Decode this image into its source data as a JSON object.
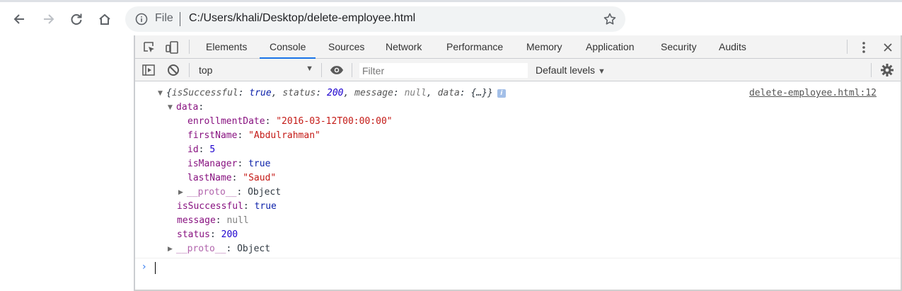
{
  "browser": {
    "scheme_label": "File",
    "url": "C:/Users/khali/Desktop/delete-employee.html",
    "icons": [
      "back-arrow-icon",
      "forward-arrow-icon",
      "reload-icon",
      "home-icon",
      "info-icon",
      "star-icon"
    ]
  },
  "devtools": {
    "tabs": [
      "Elements",
      "Console",
      "Sources",
      "Network",
      "Performance",
      "Memory",
      "Application",
      "Security",
      "Audits"
    ],
    "active_tab": "Console",
    "toolbar": {
      "context": "top",
      "filter_placeholder": "Filter",
      "levels": "Default levels"
    },
    "colors": {
      "accent": "#1a73e8",
      "string": "#c41a16",
      "number": "#1c00cf",
      "key": "#881280"
    }
  },
  "console": {
    "summary": "{isSuccessful: true, status: 200, message: null, data: {…}}",
    "summary_parts": {
      "open": "{",
      "k1": "isSuccessful",
      "v1": "true",
      "k2": "status",
      "v2": "200",
      "k3": "message",
      "v3": "null",
      "k4": "data",
      "v4": "{…}",
      "close": "}"
    },
    "source": "delete-employee.html:12",
    "data_key": "data",
    "data": {
      "enrollmentDate_key": "enrollmentDate",
      "enrollmentDate": "\"2016-03-12T00:00:00\"",
      "firstName_key": "firstName",
      "firstName": "\"Abdulrahman\"",
      "id_key": "id",
      "id": "5",
      "isManager_key": "isManager",
      "isManager": "true",
      "lastName_key": "lastName",
      "lastName": "\"Saud\"",
      "proto_key": "__proto__",
      "proto": "Object"
    },
    "top": {
      "isSuccessful_key": "isSuccessful",
      "isSuccessful": "true",
      "message_key": "message",
      "message": "null",
      "status_key": "status",
      "status": "200",
      "proto_key": "__proto__",
      "proto": "Object"
    }
  }
}
